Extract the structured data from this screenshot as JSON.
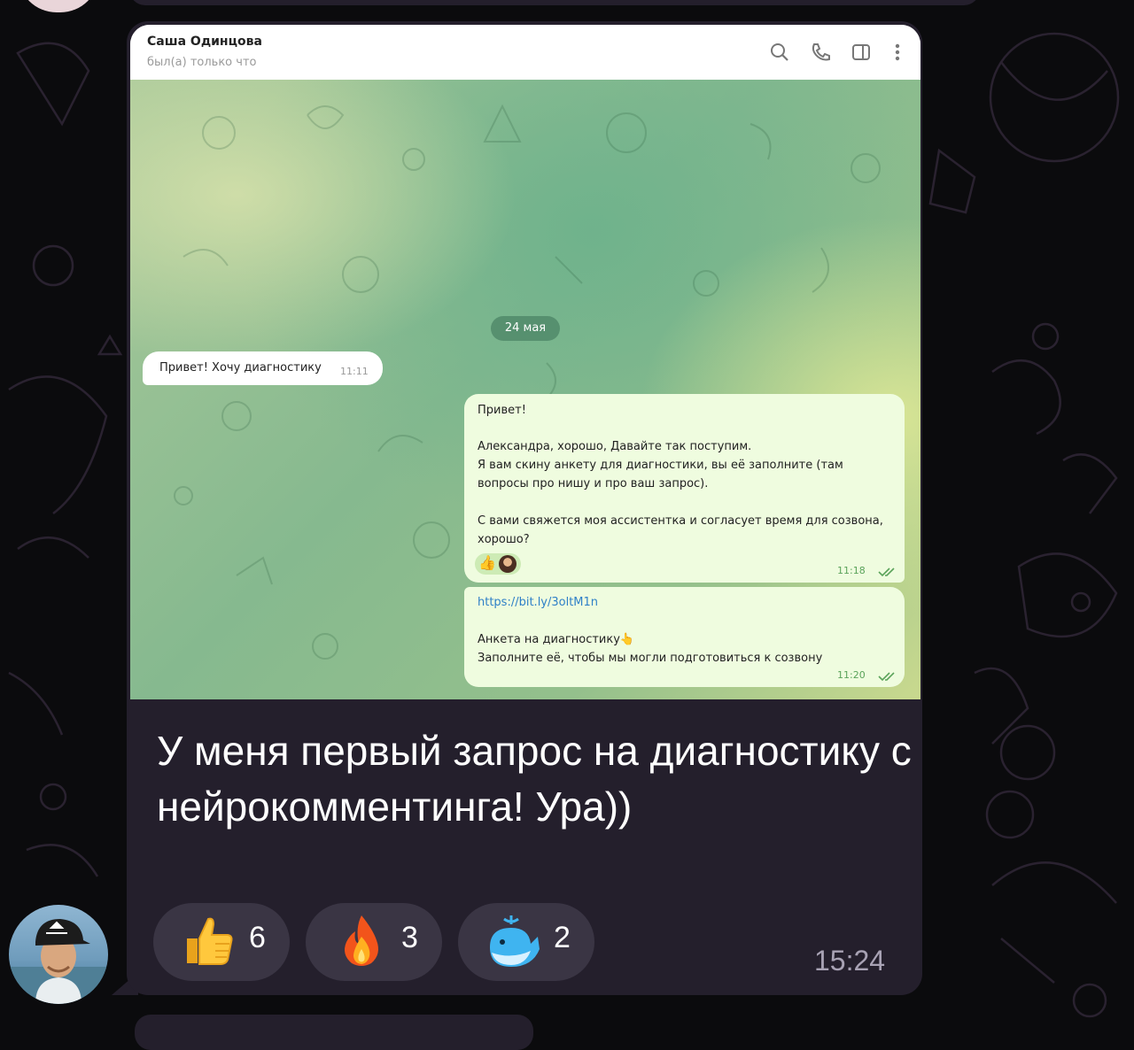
{
  "telegram_screenshot": {
    "contact_name": "Саша Одинцова",
    "contact_status": "был(а) только что",
    "date_separator": "24 мая",
    "messages": [
      {
        "direction": "in",
        "text": "Привет! Хочу диагностику",
        "time": "11:11"
      },
      {
        "direction": "out",
        "lines": [
          "Привет!",
          "",
          "Александра, хорошо, Давайте так поступим.",
          "Я вам скину анкету для диагностики, вы её заполните (там",
          "вопросы про нишу и про ваш запрос).",
          "",
          "С вами свяжется моя ассистентка и согласует время для созвона,",
          "хорошо?"
        ],
        "time": "11:18",
        "reactions": [
          "thumbs-up",
          "avatar"
        ]
      },
      {
        "direction": "out",
        "link": "https://bit.ly/3oltM1n",
        "lines": [
          "Анкета на диагностику👆",
          "Заполните её, чтобы мы могли подготовиться к созвону"
        ],
        "time": "11:20"
      }
    ]
  },
  "post": {
    "caption": "У меня первый запрос на диагностику с нейрокомментинга! Ура))",
    "time": "15:24",
    "reactions": [
      {
        "icon": "thumbs-up-icon",
        "count": "6"
      },
      {
        "icon": "fire-icon",
        "count": "3"
      },
      {
        "icon": "whale-icon",
        "count": "2"
      }
    ]
  }
}
